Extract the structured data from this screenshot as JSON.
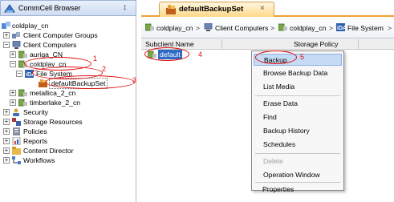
{
  "left_panel": {
    "title": "CommCell Browser",
    "pin_glyph": "↕",
    "tree": [
      {
        "label": "coldplay_cn",
        "icon": "commcell-icon",
        "level": 0,
        "expander": "minus"
      },
      {
        "label": "Client Computer Groups",
        "icon": "client-group-icon",
        "level": 1,
        "expander": "plus"
      },
      {
        "label": "Client Computers",
        "icon": "client-computers-icon",
        "level": 1,
        "expander": "minus"
      },
      {
        "label": "auriga_CN",
        "icon": "client-icon",
        "level": 2,
        "expander": "plus"
      },
      {
        "label": "coldplay_cn",
        "icon": "client-icon",
        "level": 2,
        "expander": "minus"
      },
      {
        "label": "File System",
        "icon": "file-system-icon",
        "level": 3,
        "expander": "minus"
      },
      {
        "label": "defaultBackupSet",
        "icon": "backupset-icon",
        "level": 4,
        "expander": "none"
      },
      {
        "label": "metallica_2_cn",
        "icon": "client-icon",
        "level": 2,
        "expander": "plus"
      },
      {
        "label": "timberlake_2_cn",
        "icon": "client-icon",
        "level": 2,
        "expander": "plus"
      },
      {
        "label": "Security",
        "icon": "security-icon",
        "level": 1,
        "expander": "plus"
      },
      {
        "label": "Storage Resources",
        "icon": "storage-icon",
        "level": 1,
        "expander": "plus"
      },
      {
        "label": "Policies",
        "icon": "policies-icon",
        "level": 1,
        "expander": "plus"
      },
      {
        "label": "Reports",
        "icon": "reports-icon",
        "level": 1,
        "expander": "plus"
      },
      {
        "label": "Content Director",
        "icon": "content-director-icon",
        "level": 1,
        "expander": "plus"
      },
      {
        "label": "Workflows",
        "icon": "workflows-icon",
        "level": 1,
        "expander": "plus"
      }
    ]
  },
  "tab": {
    "title": "defaultBackupSet",
    "close_glyph": "×"
  },
  "breadcrumb": {
    "items": [
      "coldplay_cn",
      "Client Computers",
      "coldplay_cn",
      "File System"
    ],
    "separator": ">"
  },
  "grid": {
    "columns": [
      "Subclient Name",
      "Storage Policy"
    ],
    "rows": [
      {
        "name": "default"
      }
    ]
  },
  "context_menu": {
    "items": [
      {
        "label": "Backup",
        "state": "highlighted"
      },
      {
        "label": "Browse Backup Data",
        "state": "normal"
      },
      {
        "label": "List Media",
        "state": "normal"
      },
      {
        "label": "Erase Data",
        "state": "normal"
      },
      {
        "label": "Find",
        "state": "normal"
      },
      {
        "label": "Backup History",
        "state": "normal"
      },
      {
        "label": "Schedules",
        "state": "normal"
      },
      {
        "label": "Delete",
        "state": "disabled"
      },
      {
        "label": "Operation Window",
        "state": "normal"
      },
      {
        "label": "Properties",
        "state": "normal"
      }
    ]
  },
  "annotations": {
    "step_numbers": [
      "1",
      "2",
      "3",
      "4",
      "5"
    ],
    "color": "#e01010"
  },
  "colors": {
    "selection": "#316ac5",
    "menu_highlight": "#c5daf3",
    "tab_accent": "#f0a030"
  }
}
